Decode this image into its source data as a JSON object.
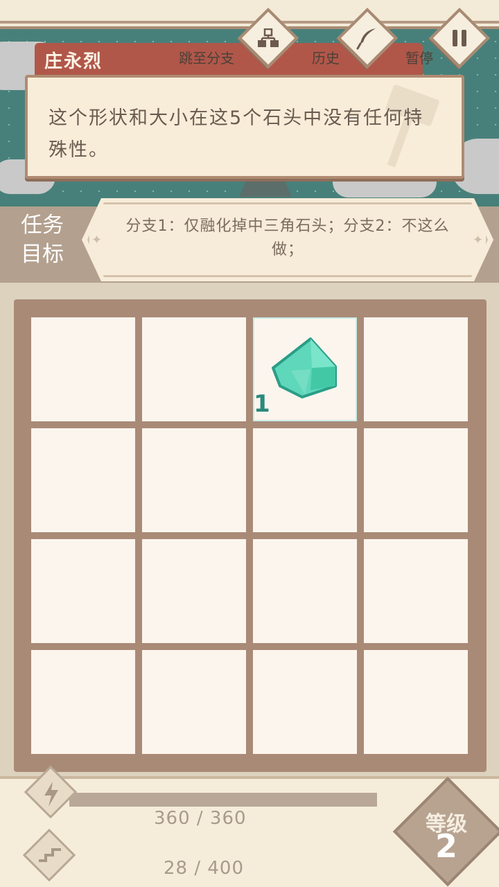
{
  "header": {
    "speaker": "庄永烈",
    "jump_label": "跳至分支",
    "history_label": "历史",
    "pause_label": "暂停"
  },
  "dialog": {
    "text": "这个形状和大小在这5个石头中没有任何特殊性。"
  },
  "mission": {
    "label_line1": "任务",
    "label_line2": "目标",
    "text": "分支1：仅融化掉中三角石头；分支2：不这么做；"
  },
  "board": {
    "rows": 4,
    "cols": 4,
    "stones": [
      {
        "row": 0,
        "col": 2,
        "number": "1",
        "color": "#58d6b8"
      }
    ]
  },
  "status": {
    "energy_text": "360 / 360",
    "energy_fraction": 1.0,
    "exp_text": "28 / 400",
    "level_label": "等级",
    "level_value": "2"
  },
  "icons": [
    "branch-icon",
    "quill-icon",
    "pause-icon",
    "lightning-icon",
    "zigzag-icon"
  ]
}
